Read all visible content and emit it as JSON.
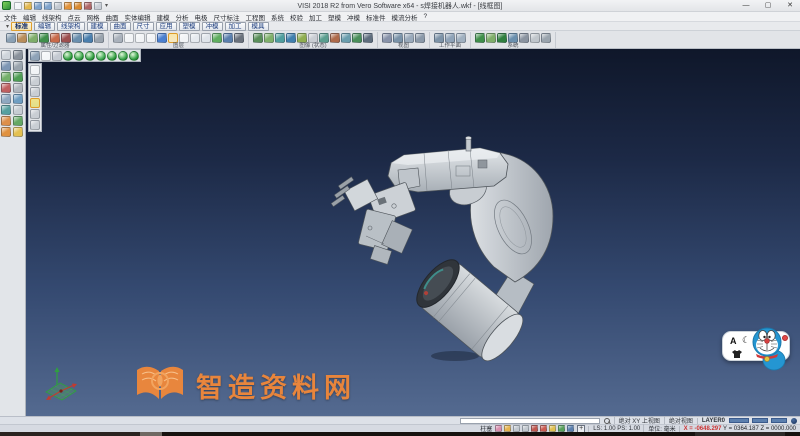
{
  "window": {
    "title": "VISI 2018 R2 from Vero Software x64 - s焊接机器人.wkf - [线框图]",
    "minimize": "—",
    "maximize": "▢",
    "close": "✕",
    "caret": "▾"
  },
  "quick_access": {
    "icons": [
      {
        "n": "new-file-icon",
        "cls": "qicon",
        "s": "--c:#f2f5f8"
      },
      {
        "n": "open-file-icon",
        "cls": "qicon",
        "s": "--c:#e3b84e"
      },
      {
        "n": "save-icon",
        "cls": "qicon",
        "s": "--c:#7fa3cc"
      },
      {
        "n": "save-all-icon",
        "cls": "qicon",
        "s": "--c:#7fa3cc"
      },
      {
        "n": "print-icon",
        "cls": "qicon",
        "s": "--c:#c3c9d1"
      },
      {
        "n": "undo-icon",
        "cls": "qicon",
        "s": "--c:#e2923a"
      },
      {
        "n": "redo-icon",
        "cls": "qicon",
        "s": "--c:#d98a30"
      },
      {
        "n": "brush-icon",
        "cls": "qicon",
        "s": "--c:#b06868"
      },
      {
        "n": "options-icon",
        "cls": "qicon",
        "s": "--c:#c9ced6"
      }
    ]
  },
  "menu_bar": {
    "items": [
      "文件",
      "编辑",
      "线架构",
      "点云",
      "网格",
      "曲面",
      "实体编辑",
      "建模",
      "分析",
      "电极",
      "尺寸标注",
      "工程图",
      "系统",
      "校验",
      "加工",
      "塑模",
      "冲模",
      "标准件",
      "模流分析",
      "?"
    ]
  },
  "tab_bar": {
    "tabs": [
      {
        "label": "标准",
        "cls": "tab selected"
      },
      {
        "label": "编辑",
        "cls": "tab"
      },
      {
        "label": "线架构",
        "cls": "tab"
      },
      {
        "label": "建模",
        "cls": "tab"
      },
      {
        "label": "曲面",
        "cls": "tab"
      },
      {
        "label": "尺寸",
        "cls": "tab"
      },
      {
        "label": "应用",
        "cls": "tab"
      },
      {
        "label": "塑模",
        "cls": "tab"
      },
      {
        "label": "冲模",
        "cls": "tab"
      },
      {
        "label": "加工",
        "cls": "tab"
      },
      {
        "label": "模具",
        "cls": "tab"
      }
    ]
  },
  "ribbon": {
    "groups": [
      {
        "label": "属性/过滤器",
        "icons": [
          {
            "n": "attribute-icon",
            "cls": "icon",
            "s": "--c:#8aa0b4"
          },
          {
            "n": "color-filter-icon",
            "cls": "icon",
            "s": "--c:#b98d5a"
          },
          {
            "n": "layer-filter-icon",
            "cls": "icon",
            "s": "--c:#7fae6a"
          },
          {
            "n": "element-filter-icon",
            "cls": "icon",
            "s": "--c:#3f8f4a"
          },
          {
            "n": "mask-icon",
            "cls": "icon",
            "s": "--c:#c96a4a"
          },
          {
            "n": "selection-filter-icon",
            "cls": "icon",
            "s": "--c:#9e4f4f"
          },
          {
            "n": "line-style-icon",
            "cls": "icon",
            "s": "--c:#6a8fae"
          },
          {
            "n": "line-weight-icon",
            "cls": "icon",
            "s": "--c:#4a7fae"
          },
          {
            "n": "properties-icon",
            "cls": "icon",
            "s": "--c:#9aa4ae"
          }
        ]
      },
      {
        "label": "图层",
        "icons": [
          {
            "n": "layer-list-icon",
            "cls": "icon",
            "s": "--c:#aab2bc"
          },
          {
            "n": "layer-new-icon",
            "cls": "icon",
            "s": "--c:#f2f4f6"
          },
          {
            "n": "layer-on-icon",
            "cls": "icon",
            "s": "--c:#f2f4f6"
          },
          {
            "n": "layer-off-icon",
            "cls": "icon",
            "s": "--c:#f2f4f6"
          },
          {
            "n": "layer-current-icon",
            "cls": "icon",
            "s": "--c:#4a7fd0"
          },
          {
            "n": "layer-active-icon",
            "cls": "icon sel",
            "s": "--c:#eef1f4"
          },
          {
            "n": "layer-freeze-icon",
            "cls": "icon",
            "s": "--c:#f2f4f6"
          },
          {
            "n": "layer-move-icon",
            "cls": "icon",
            "s": "--c:#e6eaef"
          },
          {
            "n": "layer-copy-icon",
            "cls": "icon",
            "s": "--c:#dfe4ea"
          },
          {
            "n": "layer-visible-icon",
            "cls": "icon",
            "s": "--c:#5fae5f"
          },
          {
            "n": "layer-lock-icon",
            "cls": "icon",
            "s": "--c:#5a7fae"
          },
          {
            "n": "layer-settings-icon",
            "cls": "icon",
            "s": "--c:#6a717c"
          }
        ]
      },
      {
        "label": "图像 (状态)",
        "icons": [
          {
            "n": "shade-mode-icon",
            "cls": "icon",
            "s": "--c:#5a8f5a"
          },
          {
            "n": "wireframe-mode-icon",
            "cls": "icon",
            "s": "--c:#7fb06a"
          },
          {
            "n": "hidden-line-icon",
            "cls": "icon",
            "s": "--c:#4f9e9e"
          },
          {
            "n": "render-icon",
            "cls": "icon",
            "s": "--c:#3f7fae"
          },
          {
            "n": "transparency-icon",
            "cls": "icon",
            "s": "--c:#8fae4f"
          },
          {
            "n": "texture-icon",
            "cls": "icon",
            "s": "--c:#c9cdd3"
          },
          {
            "n": "section-icon",
            "cls": "icon",
            "s": "--c:#5a9e8f"
          },
          {
            "n": "material-icon",
            "cls": "icon",
            "s": "--c:#ae6a4a"
          },
          {
            "n": "light-icon",
            "cls": "icon",
            "s": "--c:#6a9eae"
          },
          {
            "n": "background-icon",
            "cls": "icon",
            "s": "--c:#4a8f5a"
          },
          {
            "n": "display-settings-icon",
            "cls": "icon",
            "s": "--c:#5f6e7e"
          }
        ]
      },
      {
        "label": "视图",
        "icons": [
          {
            "n": "zoom-fit-icon",
            "cls": "icon",
            "s": "--c:#8893aa"
          },
          {
            "n": "zoom-window-icon",
            "cls": "icon",
            "s": "--c:#7a93a9"
          },
          {
            "n": "pan-view-icon",
            "cls": "icon",
            "s": "--c:#9aaabb"
          },
          {
            "n": "rotate-view-icon",
            "cls": "icon",
            "s": "--c:#8b99a9"
          }
        ]
      },
      {
        "label": "工作平面",
        "icons": [
          {
            "n": "workplane-new-icon",
            "cls": "icon",
            "s": "--c:#7d93a8"
          },
          {
            "n": "workplane-align-icon",
            "cls": "icon",
            "s": "--c:#8fa3b8"
          },
          {
            "n": "workplane-reset-icon",
            "cls": "icon",
            "s": "--c:#a0b0c0"
          }
        ]
      },
      {
        "label": "系统",
        "icons": [
          {
            "n": "system-map-icon",
            "cls": "icon",
            "s": "--c:#3f8f4a"
          },
          {
            "n": "system-tree-icon",
            "cls": "icon",
            "s": "--c:#7fae6a"
          },
          {
            "n": "system-globe-icon",
            "cls": "icon",
            "s": "--c:#2f7f3f"
          },
          {
            "n": "system-window-icon",
            "cls": "icon",
            "s": "--c:#6a8fae"
          },
          {
            "n": "system-grid-icon",
            "cls": "icon",
            "s": "--c:#8a93a0"
          },
          {
            "n": "system-page-icon",
            "cls": "icon",
            "s": "--c:#c0c6cc"
          },
          {
            "n": "system-config-icon",
            "cls": "icon",
            "s": "--c:#9aa4ae"
          }
        ]
      }
    ]
  },
  "view_toolbar": {
    "icons": [
      {
        "n": "ucs-grid-icon",
        "cls": "icon",
        "s": "--c:#8fa3b8"
      },
      {
        "n": "blank-view-icon",
        "cls": "icon",
        "s": "--c:#f4f6f8"
      },
      {
        "n": "box-view-icon",
        "cls": "icon",
        "s": "--c:#c4cad2"
      },
      {
        "n": "iso-view-icon",
        "cls": "icon sphere",
        "s": "--c:#2f9e3f"
      },
      {
        "n": "top-view-icon",
        "cls": "icon sphere",
        "s": "--c:#35a346"
      },
      {
        "n": "front-view-icon",
        "cls": "icon sphere",
        "s": "--c:#2f9e3f"
      },
      {
        "n": "right-view-icon",
        "cls": "icon sphere",
        "s": "--c:#3aa84f"
      },
      {
        "n": "left-view-icon",
        "cls": "icon sphere",
        "s": "--c:#2f9e3f"
      },
      {
        "n": "back-view-icon",
        "cls": "icon sphere",
        "s": "--c:#35a346"
      },
      {
        "n": "bottom-view-icon",
        "cls": "icon sphere",
        "s": "--c:#2f9e3f"
      }
    ]
  },
  "side_toolbar": {
    "icons": [
      {
        "n": "select-icon",
        "cls": "icon",
        "s": "--c:#cfd5db"
      },
      {
        "n": "delete-icon",
        "cls": "icon",
        "s": "--c:#8a929c"
      },
      {
        "n": "pan-icon",
        "cls": "icon",
        "s": "--c:#7e97b5"
      },
      {
        "n": "cube-icon",
        "cls": "icon",
        "s": "--c:#9aa4ad"
      },
      {
        "n": "plane-icon",
        "cls": "icon",
        "s": "--c:#74b06a"
      },
      {
        "n": "solid-icon",
        "cls": "icon",
        "s": "--c:#4f9e55"
      },
      {
        "n": "sketch-icon",
        "cls": "icon",
        "s": "--c:#c06060"
      },
      {
        "n": "measure-icon",
        "cls": "icon",
        "s": "--c:#b0b6bd"
      },
      {
        "n": "surface-icon",
        "cls": "icon",
        "s": "--c:#8fa8c0"
      },
      {
        "n": "cylinder-icon",
        "cls": "icon",
        "s": "--c:#6f9ec2"
      },
      {
        "n": "shell-icon",
        "cls": "icon",
        "s": "--c:#57a0a0"
      },
      {
        "n": "sheet-icon",
        "cls": "icon",
        "s": "--c:#c6ccd2"
      },
      {
        "n": "wrench-icon",
        "cls": "icon",
        "s": "--c:#dd8f4a"
      },
      {
        "n": "assembly-tree-icon",
        "cls": "icon",
        "s": "--c:#64a864"
      },
      {
        "n": "library-icon",
        "cls": "icon",
        "s": "--c:#e0913f"
      },
      {
        "n": "folder-icon",
        "cls": "icon",
        "s": "--c:#e3c050"
      }
    ]
  },
  "float_toolbar": {
    "icons": [
      {
        "n": "doc-icon",
        "cls": "icon",
        "s": "--c:#f2f4f6"
      },
      {
        "n": "list-icon",
        "cls": "icon",
        "s": "--c:#c9ced4"
      },
      {
        "n": "panel-icon",
        "cls": "icon",
        "s": "--c:#c9ced4"
      },
      {
        "n": "panel-active-icon",
        "cls": "icon sel",
        "s": "--c:#cfe49a"
      },
      {
        "n": "notes-icon",
        "cls": "icon",
        "s": "--c:#c9ced4"
      },
      {
        "n": "info-icon",
        "cls": "icon",
        "s": "--c:#c9ced4"
      }
    ]
  },
  "viewport": {
    "model_name": "industrial-robot-arm",
    "bg_top": "#0f172a",
    "bg_bottom": "#546a90",
    "model_gray": "#cdd2d6"
  },
  "watermark": {
    "text": "智造资料网",
    "color": "#e8853c"
  },
  "ime": {
    "letter": "A",
    "moon": "☾"
  },
  "status_bar": {
    "search_value": "",
    "mode": "绝对 XY 上视图",
    "view": "绝对视图",
    "layer": "LAYER0",
    "boxes": [
      {
        "n": "progress-box-1",
        "s": "width:20px"
      },
      {
        "n": "progress-box-2",
        "s": "width:16px"
      },
      {
        "n": "progress-box-3",
        "s": "width:16px"
      }
    ],
    "snap": "柱塞",
    "snap_icons": [
      {
        "n": "snap-point-icon",
        "cls": "sicon",
        "s": "--c:#d98fae"
      },
      {
        "n": "snap-mid-icon",
        "cls": "sicon",
        "s": "--c:#e6b34e"
      },
      {
        "n": "snap-center-icon",
        "cls": "sicon",
        "s": "--c:#c2c8cf"
      },
      {
        "n": "snap-quad-icon",
        "cls": "sicon",
        "s": "--c:#c2c8cf"
      },
      {
        "n": "snap-intersect-icon",
        "cls": "sicon",
        "s": "--c:#c0564e"
      },
      {
        "n": "snap-perp-icon",
        "cls": "sicon",
        "s": "--c:#cc5a50"
      },
      {
        "n": "snap-tangent-icon",
        "cls": "sicon",
        "s": "--c:#e0c050"
      },
      {
        "n": "snap-time-icon",
        "cls": "sicon",
        "s": "--c:#57a05a"
      },
      {
        "n": "snap-grid-icon",
        "cls": "sicon",
        "s": "--c:#5b7fae"
      }
    ],
    "crosshair": "+",
    "ls_ps": "LS: 1.00 PS: 1.00",
    "units": "单位: 毫米",
    "coord_x": "X = -0648.297",
    "coord_yz": "Y = 0364.187 Z = 0000.000",
    "x_color": "#cc3333"
  }
}
